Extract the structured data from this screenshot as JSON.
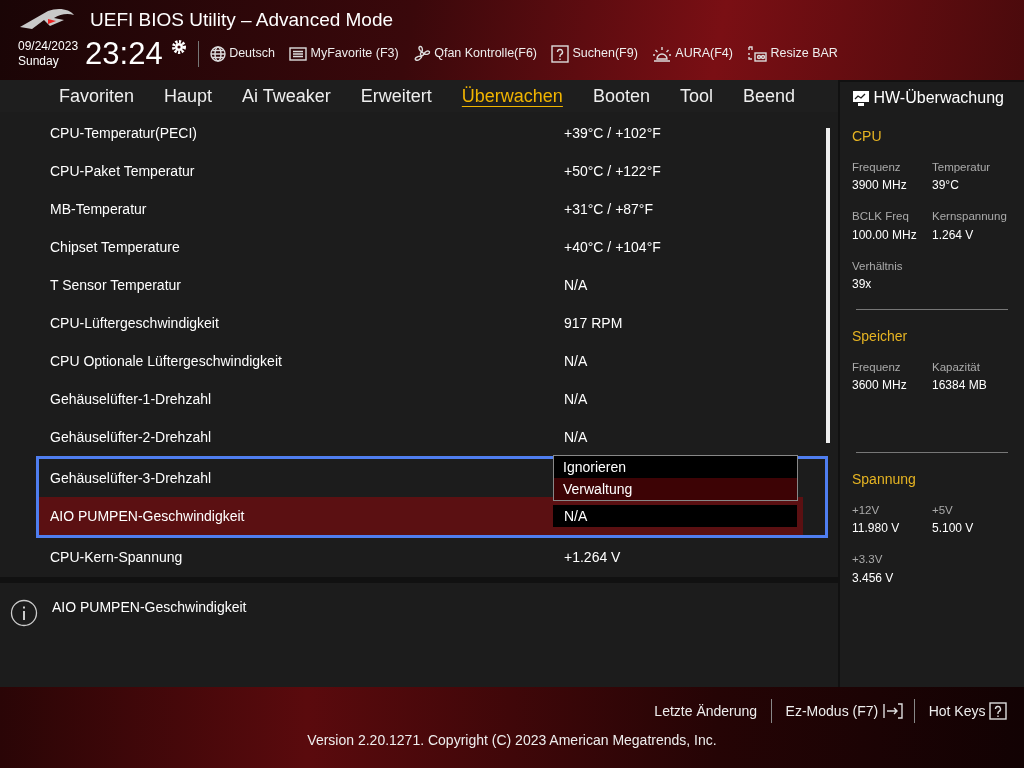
{
  "header": {
    "title": "UEFI BIOS Utility – Advanced Mode",
    "date": "09/24/2023",
    "day": "Sunday",
    "time": "23:24",
    "tools": [
      {
        "label": "Deutsch"
      },
      {
        "label": "MyFavorite (F3)"
      },
      {
        "label": "Qfan Kontrolle(F6)"
      },
      {
        "label": "Suchen(F9)"
      },
      {
        "label": "AURA(F4)"
      },
      {
        "label": "Resize BAR"
      }
    ]
  },
  "tabs": [
    {
      "label": "Favoriten",
      "selected": false
    },
    {
      "label": "Haupt",
      "selected": false
    },
    {
      "label": "Ai Tweaker",
      "selected": false
    },
    {
      "label": "Erweitert",
      "selected": false
    },
    {
      "label": "Überwachen",
      "selected": true
    },
    {
      "label": "Booten",
      "selected": false
    },
    {
      "label": "Tool",
      "selected": false
    },
    {
      "label": "Beend",
      "selected": false
    }
  ],
  "settings": [
    {
      "label": "CPU-Temperatur(PECI)",
      "value": "+39°C / +102°F",
      "selected": false,
      "focused": false
    },
    {
      "label": "CPU-Paket Temperatur",
      "value": "+50°C / +122°F",
      "selected": false,
      "focused": false
    },
    {
      "label": "MB-Temperatur",
      "value": "+31°C / +87°F",
      "selected": false,
      "focused": false
    },
    {
      "label": "Chipset Temperature",
      "value": "+40°C / +104°F",
      "selected": false,
      "focused": false
    },
    {
      "label": "T Sensor Temperatur",
      "value": "N/A",
      "selected": false,
      "focused": false
    },
    {
      "label": "CPU-Lüftergeschwindigkeit",
      "value": "917 RPM",
      "selected": false,
      "focused": false
    },
    {
      "label": "CPU Optionale Lüftergeschwindigkeit",
      "value": "N/A",
      "selected": false,
      "focused": false
    },
    {
      "label": "Gehäuselüfter-1-Drehzahl",
      "value": "N/A",
      "selected": false,
      "focused": false
    },
    {
      "label": "Gehäuselüfter-2-Drehzahl",
      "value": "N/A",
      "selected": false,
      "focused": false
    },
    {
      "label": "Gehäuselüfter-3-Drehzahl",
      "selected": false,
      "focused": true,
      "dropdown": [
        {
          "label": "Ignorieren",
          "selected": false
        },
        {
          "label": "Verwaltung",
          "selected": true
        }
      ]
    },
    {
      "label": "AIO PUMPEN-Geschwindigkeit",
      "value": "N/A",
      "selected": true,
      "focused": true
    },
    {
      "label": "CPU-Kern-Spannung",
      "value": "+1.264 V",
      "selected": false,
      "focused": false
    }
  ],
  "help": {
    "text": "AIO PUMPEN-Geschwindigkeit"
  },
  "monitor": {
    "title": "HW-Überwachung",
    "sections": [
      {
        "title": "CPU",
        "items": [
          {
            "label": "Frequenz",
            "value": "3900 MHz"
          },
          {
            "label": "Temperatur",
            "value": "39°C"
          },
          {
            "label": "BCLK Freq",
            "value": "100.00 MHz"
          },
          {
            "label": "Kernspannung",
            "value": "1.264 V"
          },
          {
            "label": "Verhältnis",
            "value": "39x"
          }
        ]
      },
      {
        "title": "Speicher",
        "items": [
          {
            "label": "Frequenz",
            "value": "3600 MHz"
          },
          {
            "label": "Kapazität",
            "value": "16384 MB"
          }
        ]
      },
      {
        "title": "Spannung",
        "items": [
          {
            "label": "+12V",
            "value": "11.980 V"
          },
          {
            "label": "+5V",
            "value": "5.100 V"
          },
          {
            "label": "+3.3V",
            "value": "3.456 V"
          }
        ]
      }
    ]
  },
  "footer": {
    "actions": [
      {
        "label": "Letzte Änderung"
      },
      {
        "label": "Ez-Modus (F7)"
      },
      {
        "label": "Hot Keys"
      }
    ],
    "version": "Version 2.20.1271. Copyright (C) 2023 American Megatrends, Inc."
  }
}
